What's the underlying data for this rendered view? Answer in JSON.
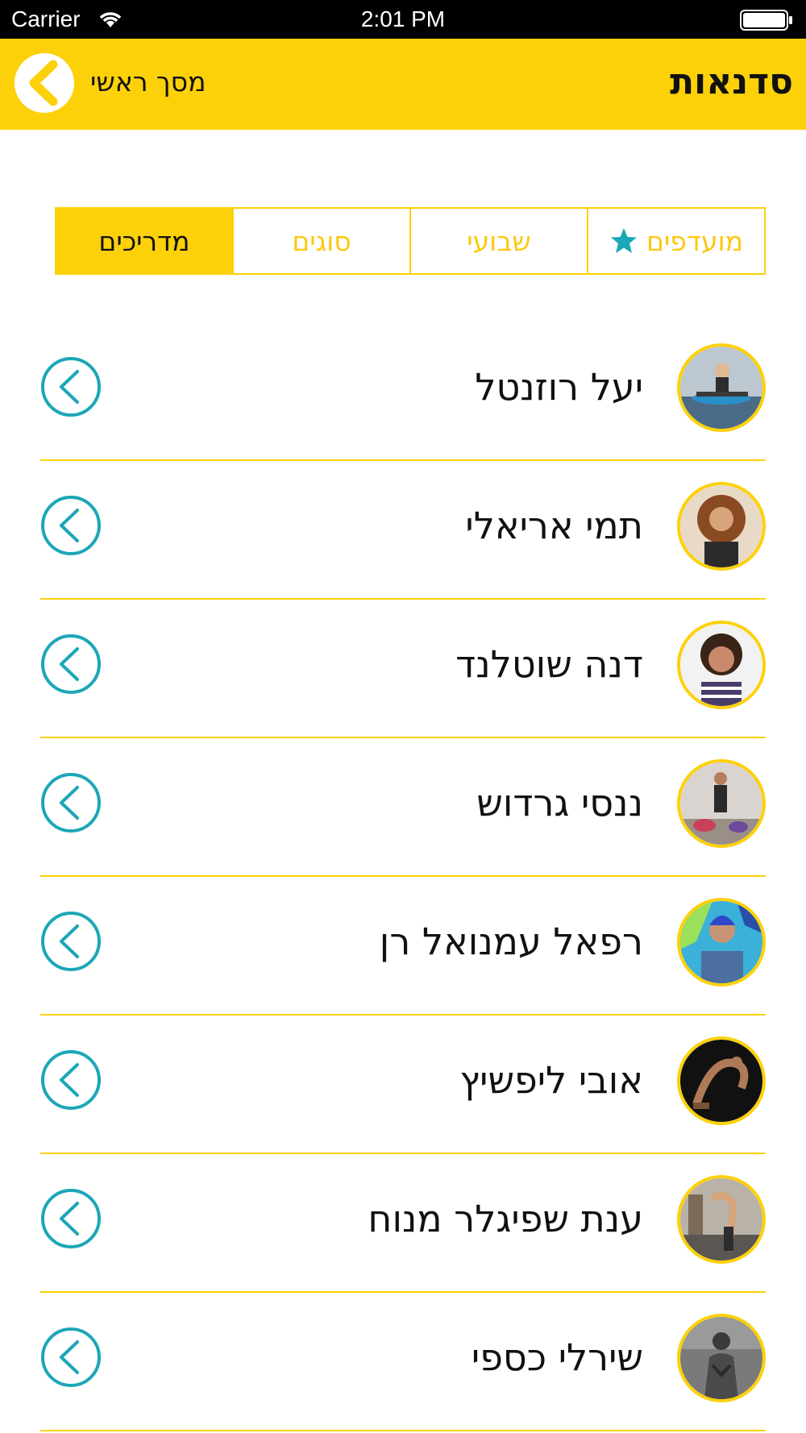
{
  "status_bar": {
    "carrier": "Carrier",
    "time": "2:01 PM"
  },
  "header": {
    "title": "סדנאות",
    "back_label": "מסך ראשי"
  },
  "tabs": [
    {
      "label": "מועדפים",
      "icon": "star-icon",
      "active": false
    },
    {
      "label": "שבועי",
      "active": false
    },
    {
      "label": "סוגים",
      "active": false
    },
    {
      "label": "מדריכים",
      "active": true
    }
  ],
  "instructors": [
    {
      "name": "יעל רוזנטל"
    },
    {
      "name": "תמי אריאלי"
    },
    {
      "name": "דנה שוטלנד"
    },
    {
      "name": "ננסי גרדוש"
    },
    {
      "name": "רפאל עמנואל רן"
    },
    {
      "name": "אובי ליפשיץ"
    },
    {
      "name": "ענת שפיגלר מנוח"
    },
    {
      "name": "שירלי כספי"
    }
  ],
  "colors": {
    "accent_yellow": "#fdd10a",
    "chevron_teal": "#1ba7b7",
    "star_teal": "#1ba7b7"
  }
}
